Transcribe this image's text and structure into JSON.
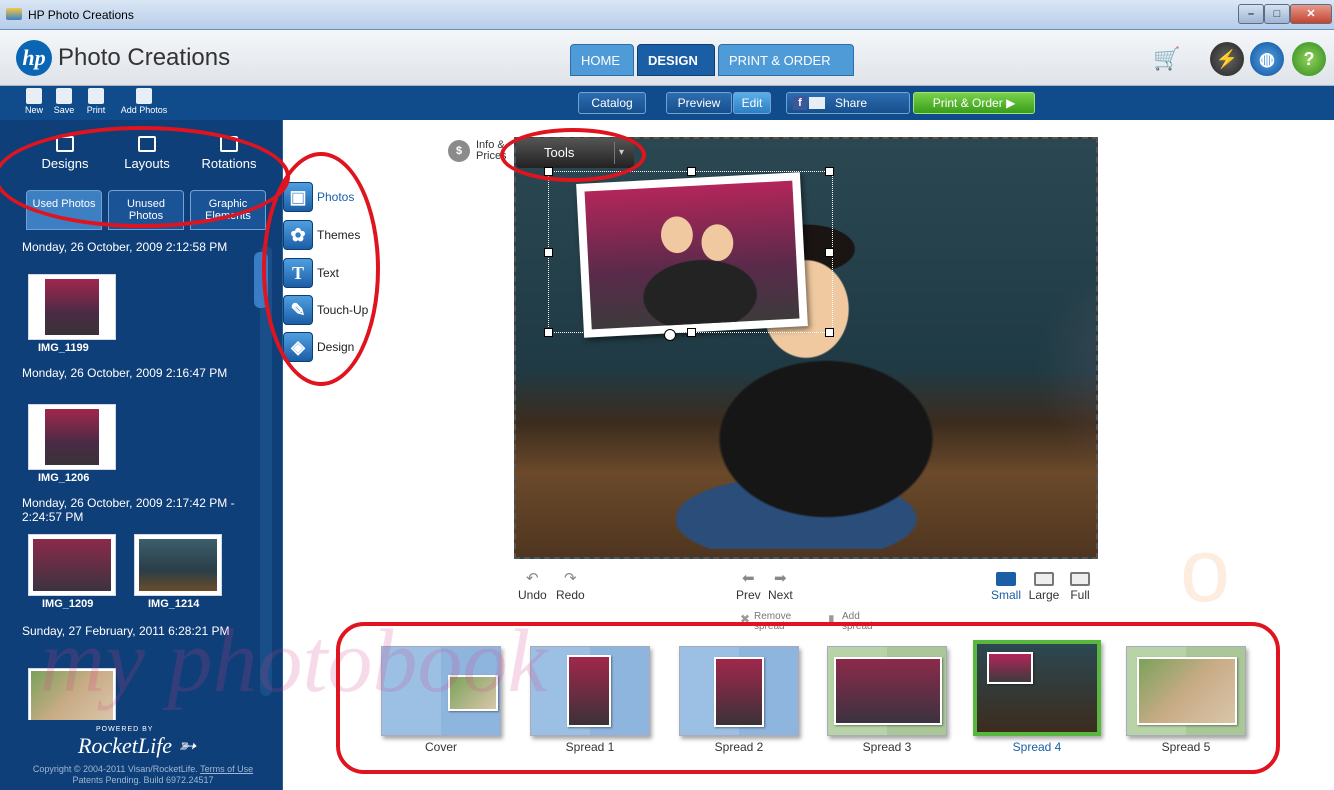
{
  "window": {
    "title": "HP Photo Creations",
    "min_label": "–",
    "max_label": "□",
    "close_label": "✕"
  },
  "header": {
    "logo_text": "hp",
    "brand": "Photo Creations",
    "tabs": [
      {
        "label": "HOME",
        "active": false
      },
      {
        "label": "DESIGN",
        "active": true
      },
      {
        "label": "PRINT & ORDER",
        "active": false
      }
    ],
    "icons": [
      "shopping-cart-icon",
      "bolt-icon",
      "globe-icon",
      "help-icon"
    ]
  },
  "subbar": {
    "catalog": "Catalog",
    "preview": "Preview",
    "edit": "Edit",
    "share": "Share",
    "print_order": "Print & Order"
  },
  "left_toolbar": [
    {
      "label": "New",
      "icon": "new-icon"
    },
    {
      "label": "Save",
      "icon": "save-icon"
    },
    {
      "label": "Print",
      "icon": "print-icon"
    },
    {
      "label": "Add Photos",
      "icon": "add-photos-icon"
    }
  ],
  "category_tabs": [
    {
      "label": "Designs",
      "icon": "designs-icon"
    },
    {
      "label": "Layouts",
      "icon": "layouts-icon"
    },
    {
      "label": "Rotations",
      "icon": "rotations-icon"
    }
  ],
  "photo_tabs": [
    {
      "label": "Used Photos",
      "active": true
    },
    {
      "label": "Unused Photos",
      "active": false
    },
    {
      "label": "Graphic Elements",
      "active": false
    }
  ],
  "photo_groups": [
    {
      "label": "Monday, 26 October, 2009 2:12:58 PM",
      "photos": [
        "IMG_1199"
      ]
    },
    {
      "label": "Monday, 26 October, 2009 2:16:47 PM",
      "photos": [
        "IMG_1206"
      ]
    },
    {
      "label": "Monday, 26 October, 2009 2:17:42 PM - 2:24:57 PM",
      "photos": [
        "IMG_1209",
        "IMG_1214"
      ]
    },
    {
      "label": "Sunday, 27 February, 2011 6:28:21 PM",
      "photos": []
    }
  ],
  "footer": {
    "powered_by": "POWERED BY",
    "brand": "RocketLife",
    "copyright": "Copyright © 2004-2011 Visan/RocketLife.",
    "terms": "Terms of Use",
    "patents": "Patents Pending. Build 6972.24517"
  },
  "side_tools": [
    {
      "label": "Photos",
      "icon": "photos-tool-icon",
      "selected": true
    },
    {
      "label": "Themes",
      "icon": "themes-tool-icon",
      "selected": false
    },
    {
      "label": "Text",
      "icon": "text-tool-icon",
      "selected": false
    },
    {
      "label": "Touch-Up",
      "icon": "touch-up-tool-icon",
      "selected": false
    },
    {
      "label": "Design",
      "icon": "design-tool-icon",
      "selected": false
    }
  ],
  "canvas": {
    "info_prices": "Info & Prices",
    "tools_button": "Tools",
    "undo": "Undo",
    "redo": "Redo",
    "prev": "Prev",
    "next": "Next",
    "remove_spread": "Remove spread",
    "add_spread": "Add spread",
    "views": [
      {
        "label": "Small",
        "selected": true
      },
      {
        "label": "Large",
        "selected": false
      },
      {
        "label": "Full",
        "selected": false
      }
    ]
  },
  "spreads": [
    {
      "label": "Cover",
      "selected": false
    },
    {
      "label": "Spread 1",
      "selected": false
    },
    {
      "label": "Spread 2",
      "selected": false
    },
    {
      "label": "Spread 3",
      "selected": false
    },
    {
      "label": "Spread 4",
      "selected": true
    },
    {
      "label": "Spread 5",
      "selected": false
    }
  ],
  "colors": {
    "panel_bg": "#0f3f78",
    "accent": "#1a5ea5",
    "order_green": "#3a9c1a",
    "annotation_red": "#e0141e",
    "selected_spread": "#57b73f"
  }
}
